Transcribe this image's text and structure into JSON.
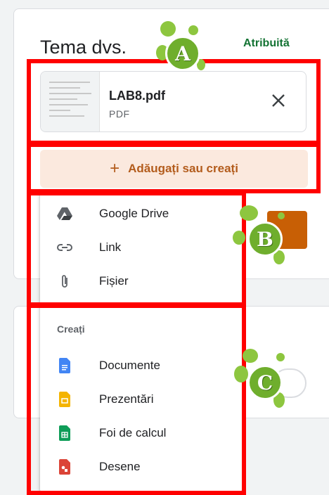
{
  "assignment": {
    "title": "Tema dvs.",
    "status": "Atribuită"
  },
  "attachment": {
    "name": "LAB8.pdf",
    "type": "PDF"
  },
  "add_button": {
    "icon": "+",
    "label": "Adăugați sau creați"
  },
  "menu": {
    "items": [
      {
        "label": "Google Drive",
        "icon": "google-drive-icon"
      },
      {
        "label": "Link",
        "icon": "link-icon"
      },
      {
        "label": "Fișier",
        "icon": "paperclip-icon"
      }
    ],
    "create_header": "Creați",
    "create_items": [
      {
        "label": "Documente",
        "icon": "docs-icon",
        "color": "#4285f4"
      },
      {
        "label": "Prezentări",
        "icon": "slides-icon",
        "color": "#f4b400"
      },
      {
        "label": "Foi de calcul",
        "icon": "sheets-icon",
        "color": "#0f9d58"
      },
      {
        "label": "Desene",
        "icon": "drawings-icon",
        "color": "#db4437"
      }
    ]
  },
  "annotations": {
    "a": "A",
    "b": "B",
    "c": "C"
  },
  "colors": {
    "highlight": "#ff0000",
    "accent_orange": "#c85f05",
    "badge_green": "#6fae2d"
  }
}
